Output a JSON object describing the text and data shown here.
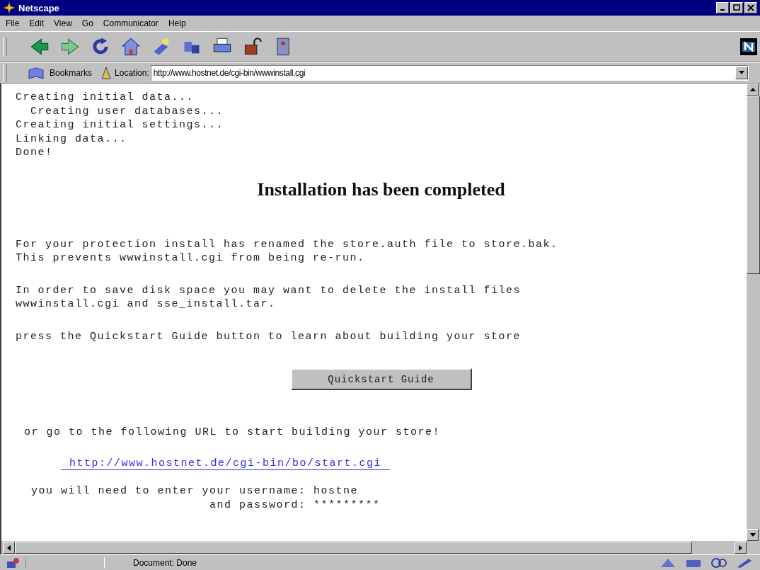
{
  "window": {
    "title": "Netscape"
  },
  "menu": [
    "File",
    "Edit",
    "View",
    "Go",
    "Communicator",
    "Help"
  ],
  "location_bar": {
    "bookmarks": "Bookmarks",
    "label": "Location:",
    "url": "http://www.hostnet.de/cgi-bin/wwwinstall.cgi"
  },
  "log": [
    "Creating initial data...",
    "  Creating user databases...",
    "Creating initial settings...",
    "Linking data...",
    "Done!"
  ],
  "heading": "Installation has been completed",
  "paragraphs": [
    "For your protection install has renamed the store.auth file to store.bak.\nThis prevents wwwinstall.cgi from being re-run.",
    "In order to save disk space you may want to delete the install files\nwwwinstall.cgi and sse_install.tar.",
    "press the Quickstart Guide button to learn about building your store"
  ],
  "button": "Quickstart Guide",
  "url_note": "or go to the following URL to start building your store!",
  "link": "http://www.hostnet.de/cgi-bin/bo/start.cgi",
  "credentials": "you will need to enter your username: hostne\n                        and password: *********",
  "status_bar": {
    "text": "Document: Done"
  }
}
